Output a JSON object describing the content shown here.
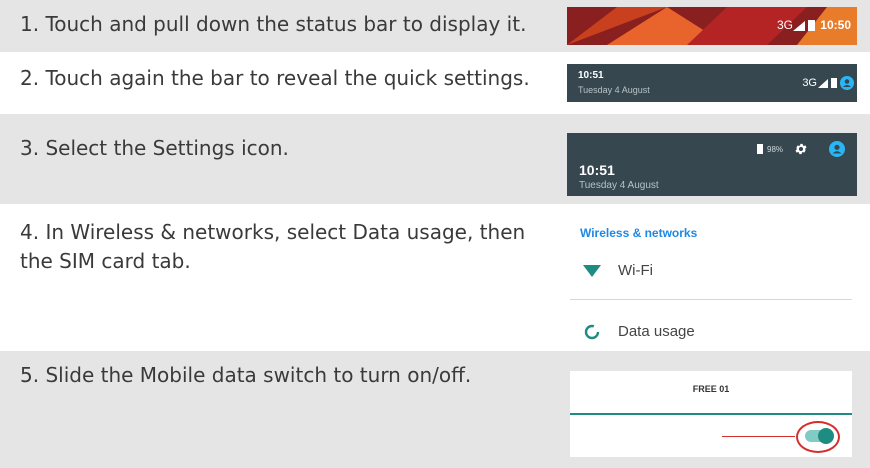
{
  "steps": [
    {
      "text": "1. Touch and pull down the status bar to display it."
    },
    {
      "text": "2. Touch again the bar to reveal the quick settings."
    },
    {
      "text": "3. Select the Settings icon."
    },
    {
      "text": "4. In Wireless & networks, select Data usage, then the SIM card tab."
    },
    {
      "text": "5. Slide the Mobile data switch to turn on/off."
    }
  ],
  "shot1": {
    "network": "3G",
    "time": "10:50"
  },
  "shot2": {
    "time": "10:51",
    "date": "Tuesday 4 August",
    "network": "3G"
  },
  "shot3": {
    "battery": "98%",
    "time": "10:51",
    "date": "Tuesday 4 August"
  },
  "shot4": {
    "header": "Wireless & networks",
    "item1": "Wi-Fi",
    "item2": "Data usage"
  },
  "shot5": {
    "tab": "FREE 01",
    "switch_on": true
  },
  "colors": {
    "accent": "#1e88e5",
    "teal": "#1e8c80",
    "highlight": "#d32f2f",
    "status_dark": "#37474f"
  }
}
